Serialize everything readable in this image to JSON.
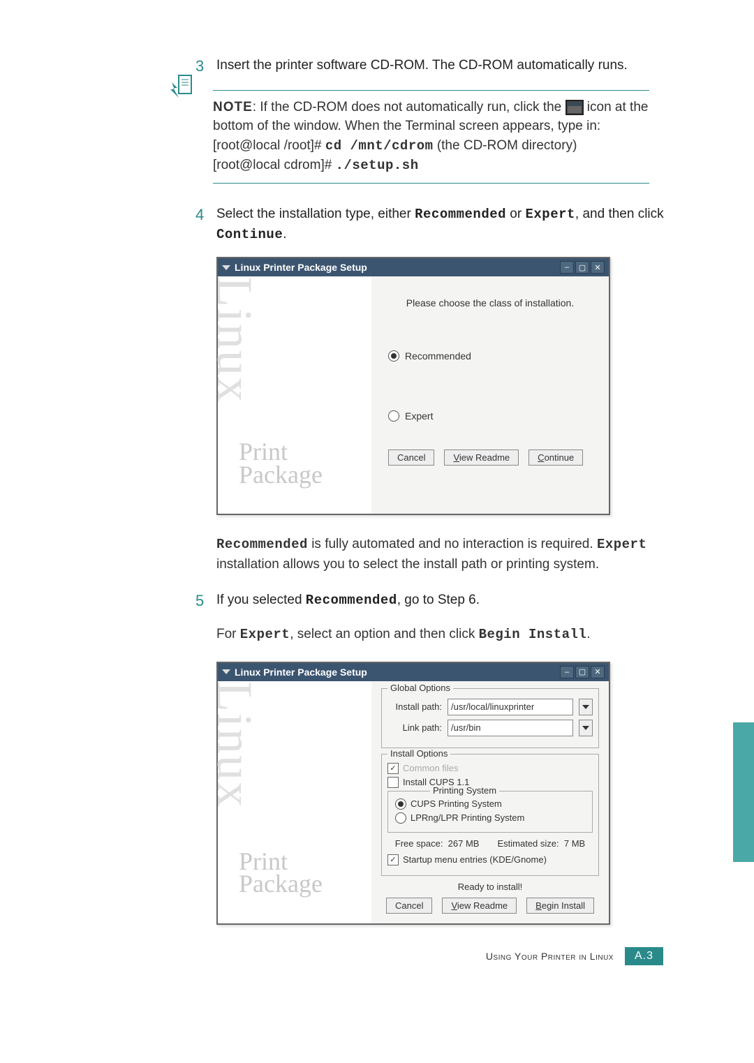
{
  "steps": {
    "s3": {
      "num": "3",
      "text_a": "Insert the printer software CD-ROM. The CD-ROM automatically runs."
    },
    "s4": {
      "num": "4",
      "text_prefix": "Select the installation type, either ",
      "opt1": "Recommended",
      "mid": " or ",
      "opt2": "Expert",
      "suffix": ", and then click ",
      "btn": "Continue",
      "end": "."
    },
    "s5": {
      "num": "5",
      "prefix": "If you selected ",
      "opt": "Recommended",
      "suffix": ", go to Step 6."
    }
  },
  "note": {
    "label": "NOTE",
    "line1": ": If the CD-ROM does not automatically run, click the ",
    "line2": " icon at the bottom of the window. When the Terminal screen appears, type in:",
    "cmd1_prefix": "[root@local /root]# ",
    "cmd1_bold": "cd /mnt/cdrom",
    "cmd1_suffix": " (the CD-ROM directory)",
    "cmd2_prefix": "[root@local cdrom]# ",
    "cmd2_bold": "./setup.sh"
  },
  "installer1": {
    "title": "Linux Printer Package Setup",
    "caption": "Please choose the class of installation.",
    "opt_recommended": "Recommended",
    "opt_expert": "Expert",
    "btn_cancel": "Cancel",
    "btn_view": "View Readme",
    "btn_continue": "Continue",
    "banner_top": "Linux",
    "banner_line1": "Print",
    "banner_line2": "Package"
  },
  "para_after": {
    "p1a": "Recommended",
    "p1b": " is fully automated and no interaction is required. ",
    "p1c": "Expert",
    "p1d": " installation allows you to select the install path or printing system."
  },
  "expert_line": {
    "prefix": "For ",
    "opt": "Expert",
    "mid": ", select an option and then click ",
    "btn": "Begin Install",
    "end": "."
  },
  "installer2": {
    "title": "Linux Printer Package Setup",
    "global_legend": "Global Options",
    "install_path_label": "Install path:",
    "install_path_value": "/usr/local/linuxprinter",
    "link_path_label": "Link path:",
    "link_path_value": "/usr/bin",
    "install_legend": "Install Options",
    "chk_common": "Common files",
    "chk_cups": "Install CUPS 1.1",
    "printing_legend": "Printing System",
    "radio_cups": "CUPS Printing System",
    "radio_lpr": "LPRng/LPR Printing System",
    "free_space_label": "Free space:",
    "free_space_value": "267 MB",
    "est_label": "Estimated size:",
    "est_value": "7 MB",
    "chk_startup": "Startup menu entries (KDE/Gnome)",
    "ready": "Ready to install!",
    "btn_cancel": "Cancel",
    "btn_view": "View Readme",
    "btn_begin": "Begin Install"
  },
  "footer": {
    "text": "Using Your Printer in Linux",
    "page": "A.3"
  }
}
